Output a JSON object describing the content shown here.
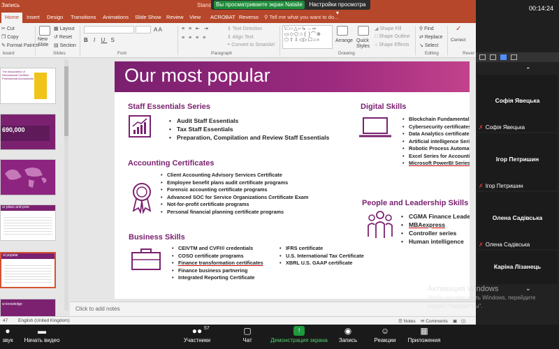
{
  "titlebar": {
    "left": "Запись",
    "center": "Standa"
  },
  "share_banner": {
    "text": "Вы просматриваете экран Natalie",
    "view_options": "Настройки просмотра"
  },
  "timer": "00:14:24",
  "menu": {
    "tabs": [
      "Home",
      "Insert",
      "Design",
      "Transitions",
      "Animations",
      "Slide Show",
      "Review",
      "View",
      "ACROBAT",
      "Reverso"
    ],
    "active": "Home",
    "tell": "Tell me what you want to do..."
  },
  "ribbon": {
    "clipboard": {
      "cut": "Cut",
      "copy": "Copy",
      "format_painter": "Format Painter",
      "label": "board"
    },
    "slides": {
      "new_slide_1": "New",
      "new_slide_2": "Slide",
      "layout": "Layout",
      "reset": "Reset",
      "section": "Section",
      "label": "Slides"
    },
    "font": {
      "label": "Font"
    },
    "paragraph": {
      "text_direction": "Text Direction",
      "align_text": "Align Text",
      "smartart": "Convert to SmartArt",
      "label": "Paragraph"
    },
    "drawing": {
      "quick_styles_1": "Quick",
      "quick_styles_2": "Styles",
      "shape_fill": "Shape Fill",
      "shape_outline": "Shape Outline",
      "shape_effects": "Shape Effects",
      "label": "Drawing",
      "arrange_1": "Arrange",
      "arrange_2": ""
    },
    "editing": {
      "find": "Find",
      "replace": "Replace",
      "select": "Select",
      "label": "Editing"
    },
    "reverso": {
      "label1": "Correct",
      "label2": "Rephraser",
      "label": "Rever"
    }
  },
  "slide": {
    "title": "Our most popular",
    "staff": {
      "title": "Staff Essentials Series",
      "items": [
        "Audit Staff Essentials",
        "Tax Staff Essentials",
        "Preparation, Compilation and Review Staff Essentials"
      ]
    },
    "digital": {
      "title": "Digital Skills",
      "items": [
        "Blockchain Fundamentals",
        "Cybersecurity certificates",
        "Data Analytics certificates",
        "Artificial intelligence Series",
        "Robotic Process Automation",
        "Excel Series for Accounting P",
        "Microsoft PowerBI Series"
      ]
    },
    "accounting": {
      "title": "Accounting Certificates",
      "items": [
        "Client Accounting Advisory Services Certificate",
        "Employee benefit plans audit certificate programs",
        "Forensic accounting certificate programs",
        "Advanced SOC for Service Organizations Certificate Exam",
        "Not-for-profit certificate programs",
        "Personal financial planning certificate programs"
      ]
    },
    "people": {
      "title": "People and Leadership Skills",
      "items": [
        "CGMA Finance Leadership",
        "MBAexpress",
        "Controller series",
        "Human intelligence"
      ]
    },
    "business": {
      "title": "Business Skills",
      "col1": [
        "CEIVTM and CVFI® credentials",
        "COSO certificate programs",
        "Finance transformation certificates",
        "Finance business partnering",
        "Integrated Reporting Certificate"
      ],
      "col2": [
        "IFRS certificate",
        "U.S. International Tax Certificate",
        "XBRL U.S. GAAP certificate"
      ]
    }
  },
  "thumbnails": {
    "t1_lines": [
      "The Association of",
      "International Certified",
      "Professional Accountants"
    ],
    "t2_big": "690,000",
    "t5_title": "ur plans and pore",
    "t6_title": "st popular",
    "t7_title": "w knowledge"
  },
  "notes": "Click to add notes",
  "statusbar": {
    "slide": "47",
    "language": "English (United Kingdom)",
    "notes": "Notes",
    "comments": "Comments"
  },
  "participants": [
    {
      "tile_name": "Софія Явецька",
      "label": "Софія Явецька"
    },
    {
      "tile_name": "Ігор Петришин",
      "label": "Ігор Петришин"
    },
    {
      "tile_name": "Олена Садівська",
      "label": "Олена Садівська"
    },
    {
      "tile_name": "Каріна Лізанець",
      "label": ""
    }
  ],
  "activation": {
    "title": "Активация Windows",
    "line1": "Чтобы активировать Windows, перейдите",
    "line2": "раздел \"Параметры\"."
  },
  "zoom_bar": {
    "sound": "звук",
    "video": "Начать видео",
    "participants": "Участники",
    "participants_count": "57",
    "chat": "Чат",
    "share": "Демонстрация экрана",
    "record": "Запись",
    "reactions": "Реакции",
    "apps": "Приложения"
  },
  "colors": {
    "accent": "#b7472a",
    "slide_purple": "#7b2170",
    "zoom_green": "#1e8c3a"
  }
}
